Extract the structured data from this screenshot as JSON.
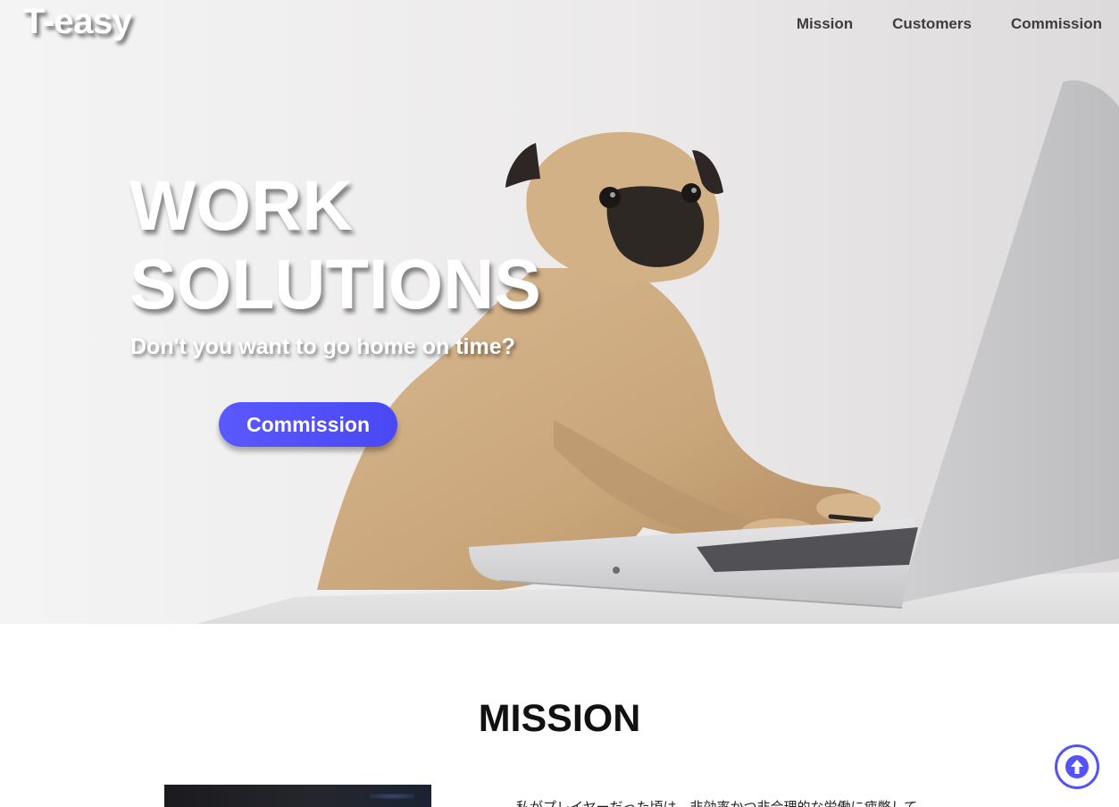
{
  "brand": {
    "logo_text": "T-easy"
  },
  "nav": {
    "items": [
      {
        "label": "Mission"
      },
      {
        "label": "Customers"
      },
      {
        "label": "Commission"
      }
    ]
  },
  "hero": {
    "title_line1": "WORK",
    "title_line2": "SOLUTIONS",
    "subtitle": "Don't you want to go home on time?",
    "cta_label": "Commission",
    "image_subject": "pug-at-laptop-photo"
  },
  "mission": {
    "title": "MISSION",
    "body_text": "私がプレイヤーだった頃は、非効率かつ非合理的な労働に疲弊して"
  },
  "back_to_top": {
    "icon": "arrow-up-circle-icon"
  },
  "colors": {
    "accent": "#5553f4",
    "button_gradient_start": "#5a58ff",
    "nav_text": "#3d3d3d",
    "hero_text": "#ffffff"
  }
}
